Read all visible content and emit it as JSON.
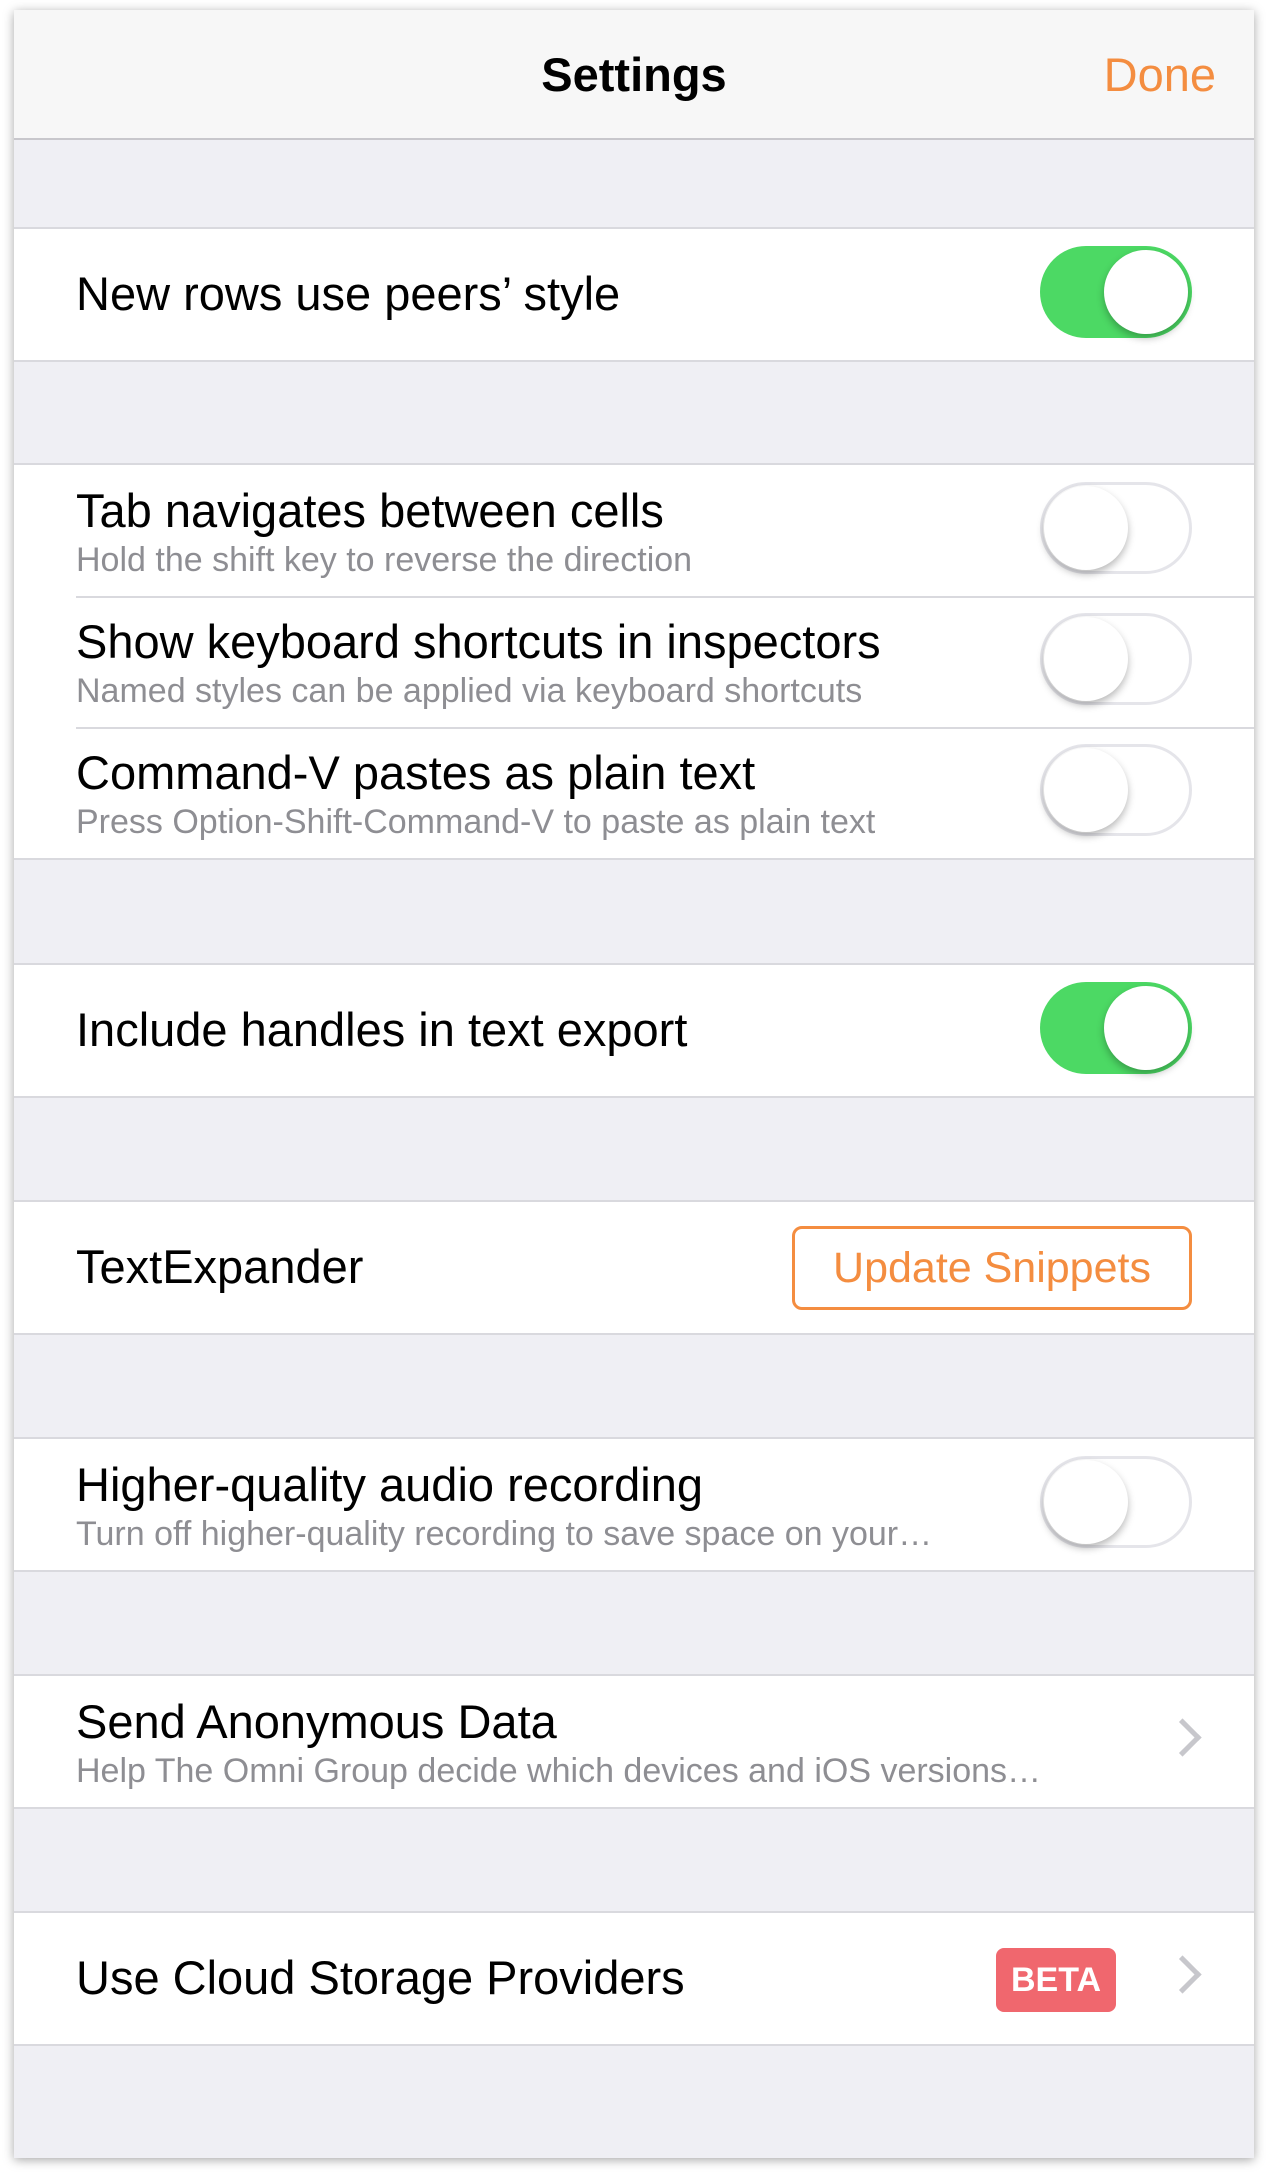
{
  "navbar": {
    "title": "Settings",
    "done_label": "Done"
  },
  "colors": {
    "accent": "#f48d40",
    "toggle_on": "#4cd964",
    "beta_badge": "#f0676e"
  },
  "settings": {
    "new_rows": {
      "label": "New rows use peers’ style",
      "on": true
    },
    "tab_navigates": {
      "label": "Tab navigates between cells",
      "subtitle": "Hold the shift key to reverse the direction",
      "on": false
    },
    "keyboard_shortcuts": {
      "label": "Show keyboard shortcuts in inspectors",
      "subtitle": "Named styles can be applied via keyboard shortcuts",
      "on": false
    },
    "paste_plain": {
      "label": "Command-V pastes as plain text",
      "subtitle": "Press Option-Shift-Command-V to paste as plain text",
      "on": false
    },
    "include_handles": {
      "label": "Include handles in text export",
      "on": true
    },
    "textexpander": {
      "label": "TextExpander",
      "button_label": "Update Snippets"
    },
    "audio_recording": {
      "label": "Higher-quality audio recording",
      "subtitle": "Turn off higher-quality recording to save space on your…",
      "on": false
    },
    "anonymous_data": {
      "label": "Send Anonymous Data",
      "subtitle": "Help The Omni Group decide which devices and iOS versions…"
    },
    "cloud_storage": {
      "label": "Use Cloud Storage Providers",
      "badge": "BETA"
    }
  }
}
